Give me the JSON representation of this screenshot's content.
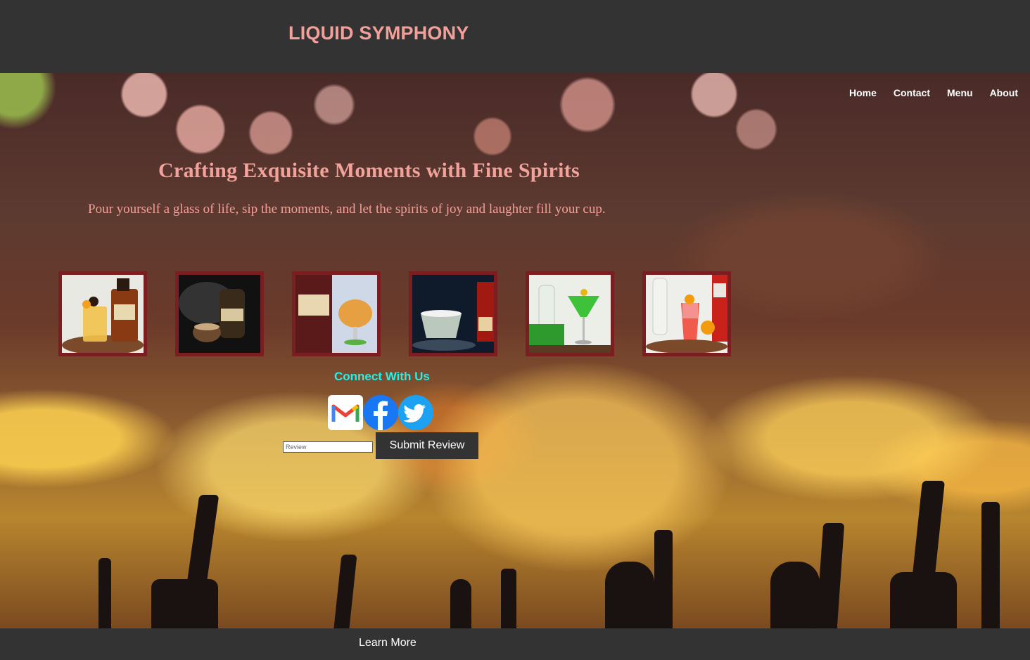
{
  "header": {
    "site_title": "LIQUID SYMPHONY"
  },
  "nav": {
    "items": [
      {
        "label": "Home"
      },
      {
        "label": "Contact"
      },
      {
        "label": "Menu"
      },
      {
        "label": "About"
      }
    ]
  },
  "hero": {
    "headline": "Crafting Exquisite Moments with Fine Spirits",
    "tagline": "Pour yourself  a glass of  life, sip the moments, and let the spirits of  joy and laughter fill your cup."
  },
  "gallery": {
    "items": [
      {
        "icon": "amaretto-cocktail-photo"
      },
      {
        "icon": "baileys-coffee-photo"
      },
      {
        "icon": "drambuie-glass-photo"
      },
      {
        "icon": "grand-marnier-margarita-photo"
      },
      {
        "icon": "midori-cocktail-photo"
      },
      {
        "icon": "campari-cocktail-photo"
      }
    ]
  },
  "connect": {
    "heading": "Connect With Us",
    "icons": [
      "gmail-icon",
      "facebook-icon",
      "twitter-icon"
    ]
  },
  "review": {
    "placeholder": "Review",
    "submit_label": "Submit Review"
  },
  "footer": {
    "learn_more": "Learn More"
  },
  "colors": {
    "header_bg": "#333333",
    "title_pink": "#f4a09a",
    "connect_cyan": "#27f0e6",
    "thumb_border": "#7a1e22"
  }
}
